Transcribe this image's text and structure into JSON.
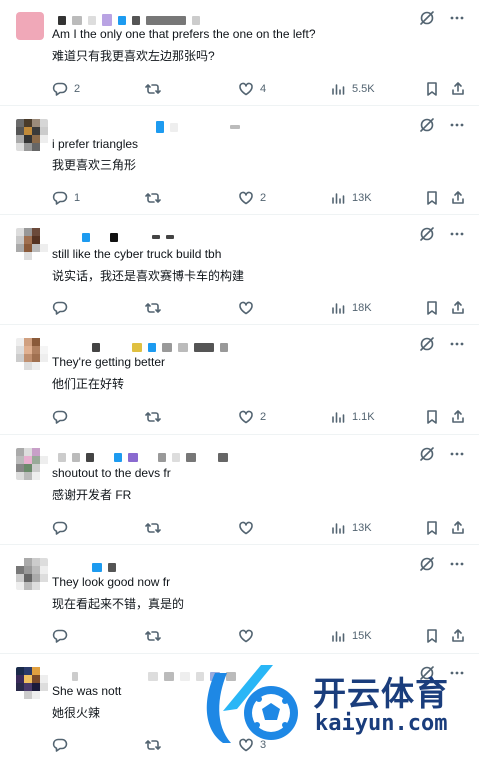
{
  "tweets": [
    {
      "text_en": "Am I the only one that prefers the one on the left?",
      "text_zh": "难道只有我更喜欢左边那张吗?",
      "replies": "2",
      "retweets": "",
      "likes": "4",
      "views": "5.5K"
    },
    {
      "text_en": "i prefer triangles",
      "text_zh": "我更喜欢三角形",
      "replies": "1",
      "retweets": "",
      "likes": "2",
      "views": "13K"
    },
    {
      "text_en": "still like the cyber truck build tbh",
      "text_zh": "说实话，我还是喜欢赛博卡车的构建",
      "replies": "",
      "retweets": "",
      "likes": "",
      "views": "18K"
    },
    {
      "text_en": "They're getting better",
      "text_zh": "他们正在好转",
      "replies": "",
      "retweets": "",
      "likes": "2",
      "views": "1.1K"
    },
    {
      "text_en": "shoutout to the devs fr",
      "text_zh": "感谢开发者 FR",
      "replies": "",
      "retweets": "",
      "likes": "",
      "views": "13K"
    },
    {
      "text_en": "They look good now fr",
      "text_zh": "现在看起来不错，真是的",
      "replies": "",
      "retweets": "",
      "likes": "",
      "views": "15K"
    },
    {
      "text_en": "She was nott",
      "text_zh": "她很火辣",
      "replies": "",
      "retweets": "",
      "likes": "3",
      "views": ""
    }
  ],
  "watermark": {
    "brand_zh": "开云体育",
    "brand_url": "kaiyun.com"
  },
  "colors": {
    "accent": "#1d9bf0",
    "muted": "#536471",
    "border": "#eff3f4",
    "wm_blue": "#1e88e5",
    "wm_dark": "#1a3d7c"
  },
  "icons": [
    "reply-icon",
    "retweet-icon",
    "like-icon",
    "views-icon",
    "bookmark-icon",
    "share-icon",
    "grok-icon",
    "more-icon"
  ]
}
